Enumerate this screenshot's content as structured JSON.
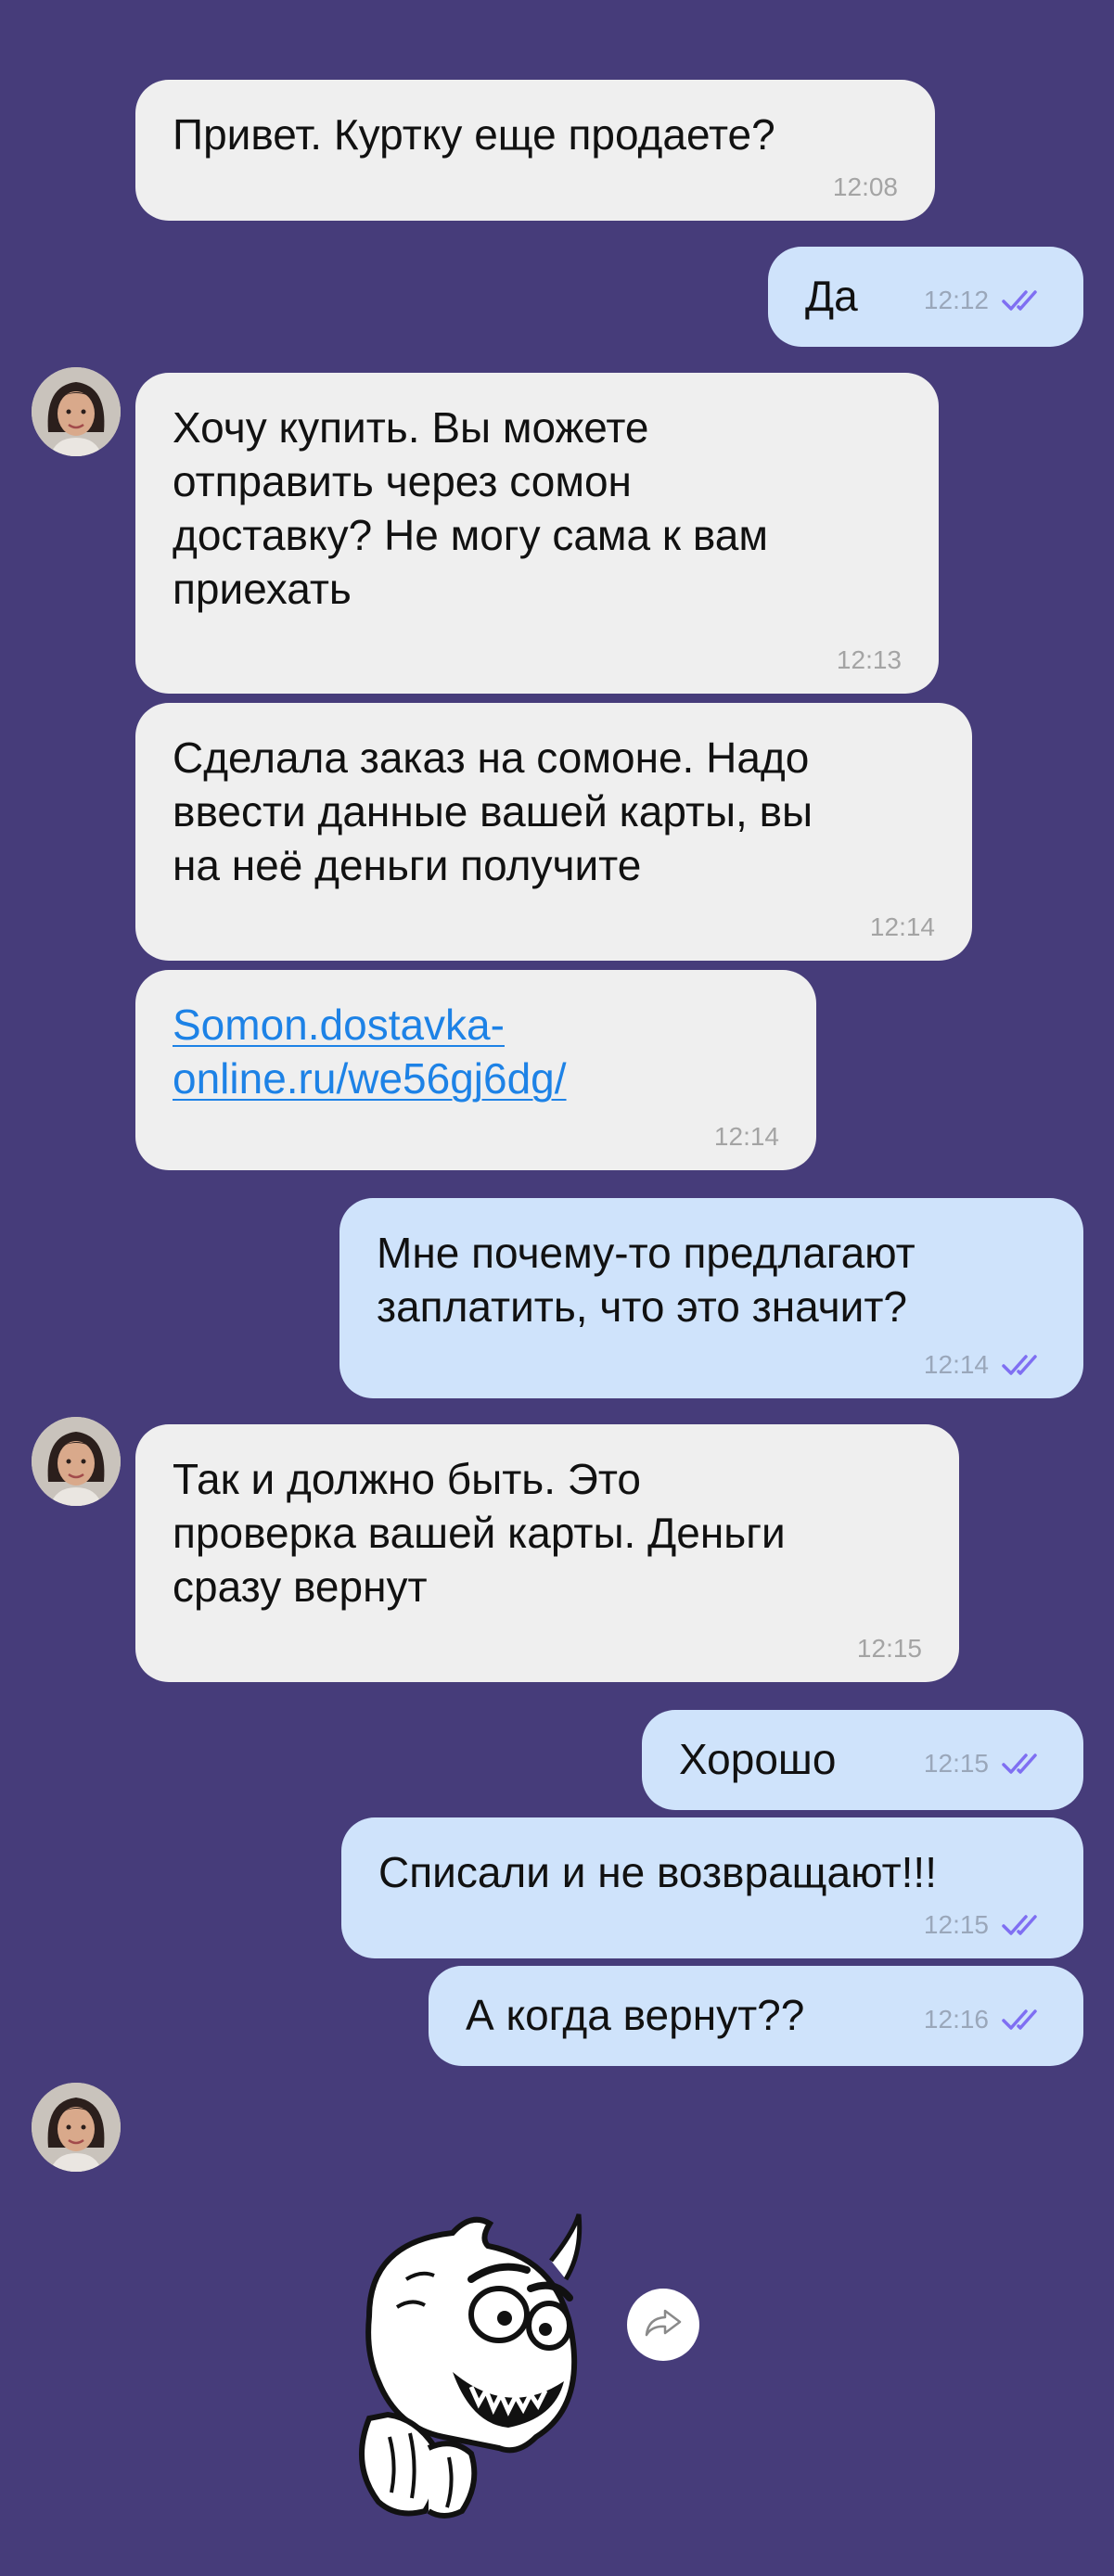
{
  "messages": [
    {
      "text": "Привет. Куртку еще продаете?",
      "time": "12:08"
    },
    {
      "text": "Да",
      "time": "12:12"
    },
    {
      "text": "Хочу купить. Вы можете\nотправить через сомон\nдоставку? Не могу сама к вам\nприехать",
      "time": "12:13"
    },
    {
      "text": "Сделала заказ на сомоне. Надо\nввести данные вашей карты, вы\nна неё деньги получите",
      "time": "12:14"
    },
    {
      "text": "Somon.dostavka-\nonline.ru/we56gj6dg/",
      "time": "12:14"
    },
    {
      "text": "Мне почему-то предлагают\nзаплатить, что это значит?",
      "time": "12:14"
    },
    {
      "text": "Так и должно быть. Это\nпроверка вашей карты. Деньги\nсразу вернут",
      "time": "12:15"
    },
    {
      "text": "Хорошо",
      "time": "12:15"
    },
    {
      "text": "Списали и не возвращают!!!",
      "time": "12:15"
    },
    {
      "text": "А когда вернут??",
      "time": "12:16"
    }
  ],
  "icons": {
    "read_receipt": "double-check-icon",
    "share": "share-arrow-icon",
    "avatar": "contact-avatar"
  },
  "colors": {
    "background": "#463c7a",
    "incoming_bubble": "#efefef",
    "outgoing_bubble": "#cfe3fb",
    "read_check": "#7f6ff2",
    "link": "#1d82e6"
  }
}
